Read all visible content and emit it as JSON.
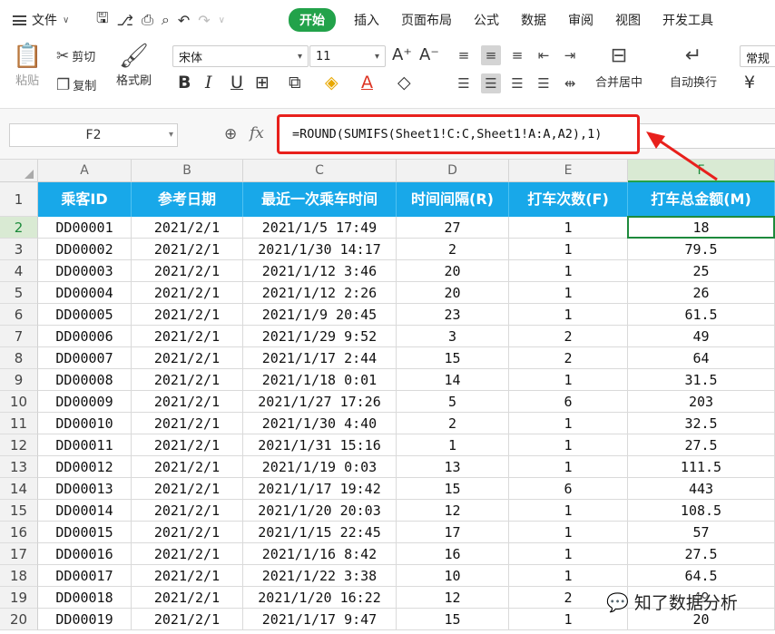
{
  "menubar": {
    "file_label": "文件",
    "tabs": [
      "开始",
      "插入",
      "页面布局",
      "公式",
      "数据",
      "审阅",
      "视图",
      "开发工具"
    ],
    "active_tab": "开始"
  },
  "ribbon": {
    "paste": "粘贴",
    "cut": "剪切",
    "copy": "复制",
    "format_painter": "格式刷",
    "font_name": "宋体",
    "font_size": "11",
    "merge_center": "合并居中",
    "wrap_text": "自动换行",
    "number_format": "常规",
    "currency": "¥"
  },
  "formula_bar": {
    "cell_ref": "F2",
    "formula": "=ROUND(SUMIFS(Sheet1!C:C,Sheet1!A:A,A2),1)"
  },
  "sheet": {
    "columns": [
      "A",
      "B",
      "C",
      "D",
      "E",
      "F"
    ],
    "selected_col": "F",
    "selected_row": 2,
    "header_row": [
      "乘客ID",
      "参考日期",
      "最近一次乘车时间",
      "时间间隔(R)",
      "打车次数(F)",
      "打车总金额(M)"
    ],
    "rows": [
      [
        "DD00001",
        "2021/2/1",
        "2021/1/5 17:49",
        "27",
        "1",
        "18"
      ],
      [
        "DD00002",
        "2021/2/1",
        "2021/1/30 14:17",
        "2",
        "1",
        "79.5"
      ],
      [
        "DD00003",
        "2021/2/1",
        "2021/1/12 3:46",
        "20",
        "1",
        "25"
      ],
      [
        "DD00004",
        "2021/2/1",
        "2021/1/12 2:26",
        "20",
        "1",
        "26"
      ],
      [
        "DD00005",
        "2021/2/1",
        "2021/1/9 20:45",
        "23",
        "1",
        "61.5"
      ],
      [
        "DD00006",
        "2021/2/1",
        "2021/1/29 9:52",
        "3",
        "2",
        "49"
      ],
      [
        "DD00007",
        "2021/2/1",
        "2021/1/17 2:44",
        "15",
        "2",
        "64"
      ],
      [
        "DD00008",
        "2021/2/1",
        "2021/1/18 0:01",
        "14",
        "1",
        "31.5"
      ],
      [
        "DD00009",
        "2021/2/1",
        "2021/1/27 17:26",
        "5",
        "6",
        "203"
      ],
      [
        "DD00010",
        "2021/2/1",
        "2021/1/30 4:40",
        "2",
        "1",
        "32.5"
      ],
      [
        "DD00011",
        "2021/2/1",
        "2021/1/31 15:16",
        "1",
        "1",
        "27.5"
      ],
      [
        "DD00012",
        "2021/2/1",
        "2021/1/19 0:03",
        "13",
        "1",
        "111.5"
      ],
      [
        "DD00013",
        "2021/2/1",
        "2021/1/17 19:42",
        "15",
        "6",
        "443"
      ],
      [
        "DD00014",
        "2021/2/1",
        "2021/1/20 20:03",
        "12",
        "1",
        "108.5"
      ],
      [
        "DD00015",
        "2021/2/1",
        "2021/1/15 22:45",
        "17",
        "1",
        "57"
      ],
      [
        "DD00016",
        "2021/2/1",
        "2021/1/16 8:42",
        "16",
        "1",
        "27.5"
      ],
      [
        "DD00017",
        "2021/2/1",
        "2021/1/22 3:38",
        "10",
        "1",
        "64.5"
      ],
      [
        "DD00018",
        "2021/2/1",
        "2021/1/20 16:22",
        "12",
        "2",
        "49"
      ],
      [
        "DD00019",
        "2021/2/1",
        "2021/1/17 9:47",
        "15",
        "1",
        "20"
      ]
    ]
  },
  "watermark": "知了数据分析",
  "colors": {
    "accent": "#22a24a",
    "header_fill": "#18a8e9",
    "highlight": "#e8201c"
  }
}
